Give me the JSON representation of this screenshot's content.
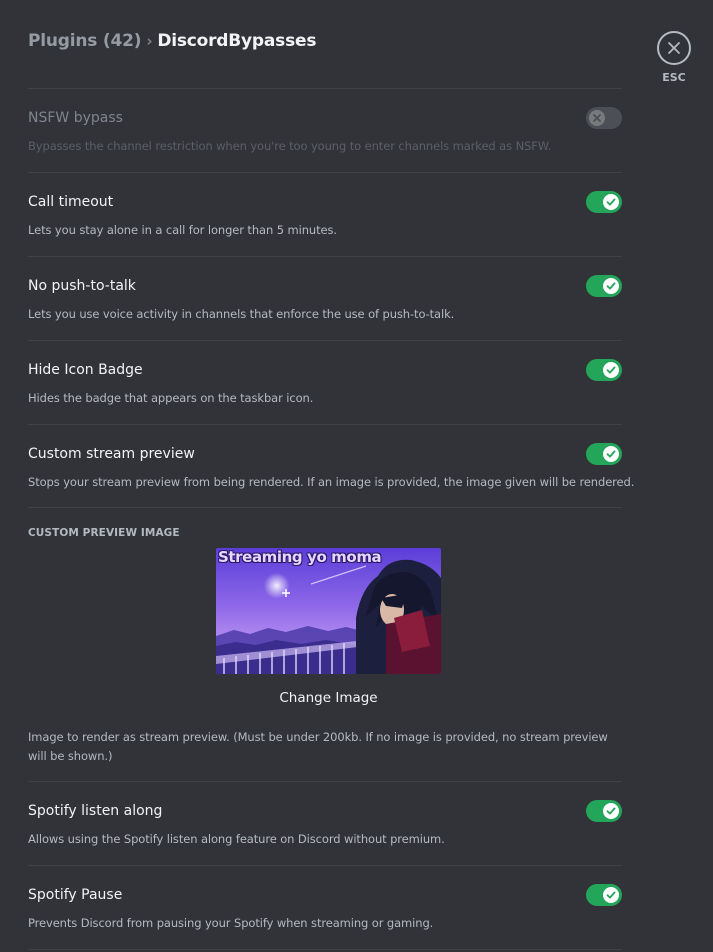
{
  "header": {
    "breadcrumb_parent": "Plugins (42)",
    "breadcrumb_separator": "›",
    "breadcrumb_current": "DiscordBypasses",
    "close_label": "ESC"
  },
  "settings": [
    {
      "title": "NSFW bypass",
      "description": "Bypasses the channel restriction when you're too young to enter channels marked as NSFW.",
      "enabled": false,
      "disabled": true
    },
    {
      "title": "Call timeout",
      "description": "Lets you stay alone in a call for longer than 5 minutes.",
      "enabled": true
    },
    {
      "title": "No push-to-talk",
      "description": "Lets you use voice activity in channels that enforce the use of push-to-talk.",
      "enabled": true
    },
    {
      "title": "Hide Icon Badge",
      "description": "Hides the badge that appears on the taskbar icon.",
      "enabled": true
    },
    {
      "title": "Custom stream preview",
      "description": "Stops your stream preview from being rendered. If an image is provided, the image given will be rendered.",
      "enabled": true
    },
    {
      "title": "Spotify listen along",
      "description": "Allows using the Spotify listen along feature on Discord without premium.",
      "enabled": true
    },
    {
      "title": "Spotify Pause",
      "description": "Prevents Discord from pausing your Spotify when streaming or gaming.",
      "enabled": true
    }
  ],
  "custom_preview": {
    "section_label": "CUSTOM PREVIEW IMAGE",
    "image_caption": "Streaming yo moma",
    "change_button": "Change Image",
    "description": "Image to render as stream preview. (Must be under 200kb. If no image is provided, no stream preview will be shown.)"
  },
  "colors": {
    "background": "#313338",
    "toggle_on": "#23a55a",
    "toggle_off": "#80848e",
    "divider": "#3f4147"
  },
  "icons": {
    "close": "close-icon",
    "check": "check-icon",
    "x": "x-icon"
  }
}
